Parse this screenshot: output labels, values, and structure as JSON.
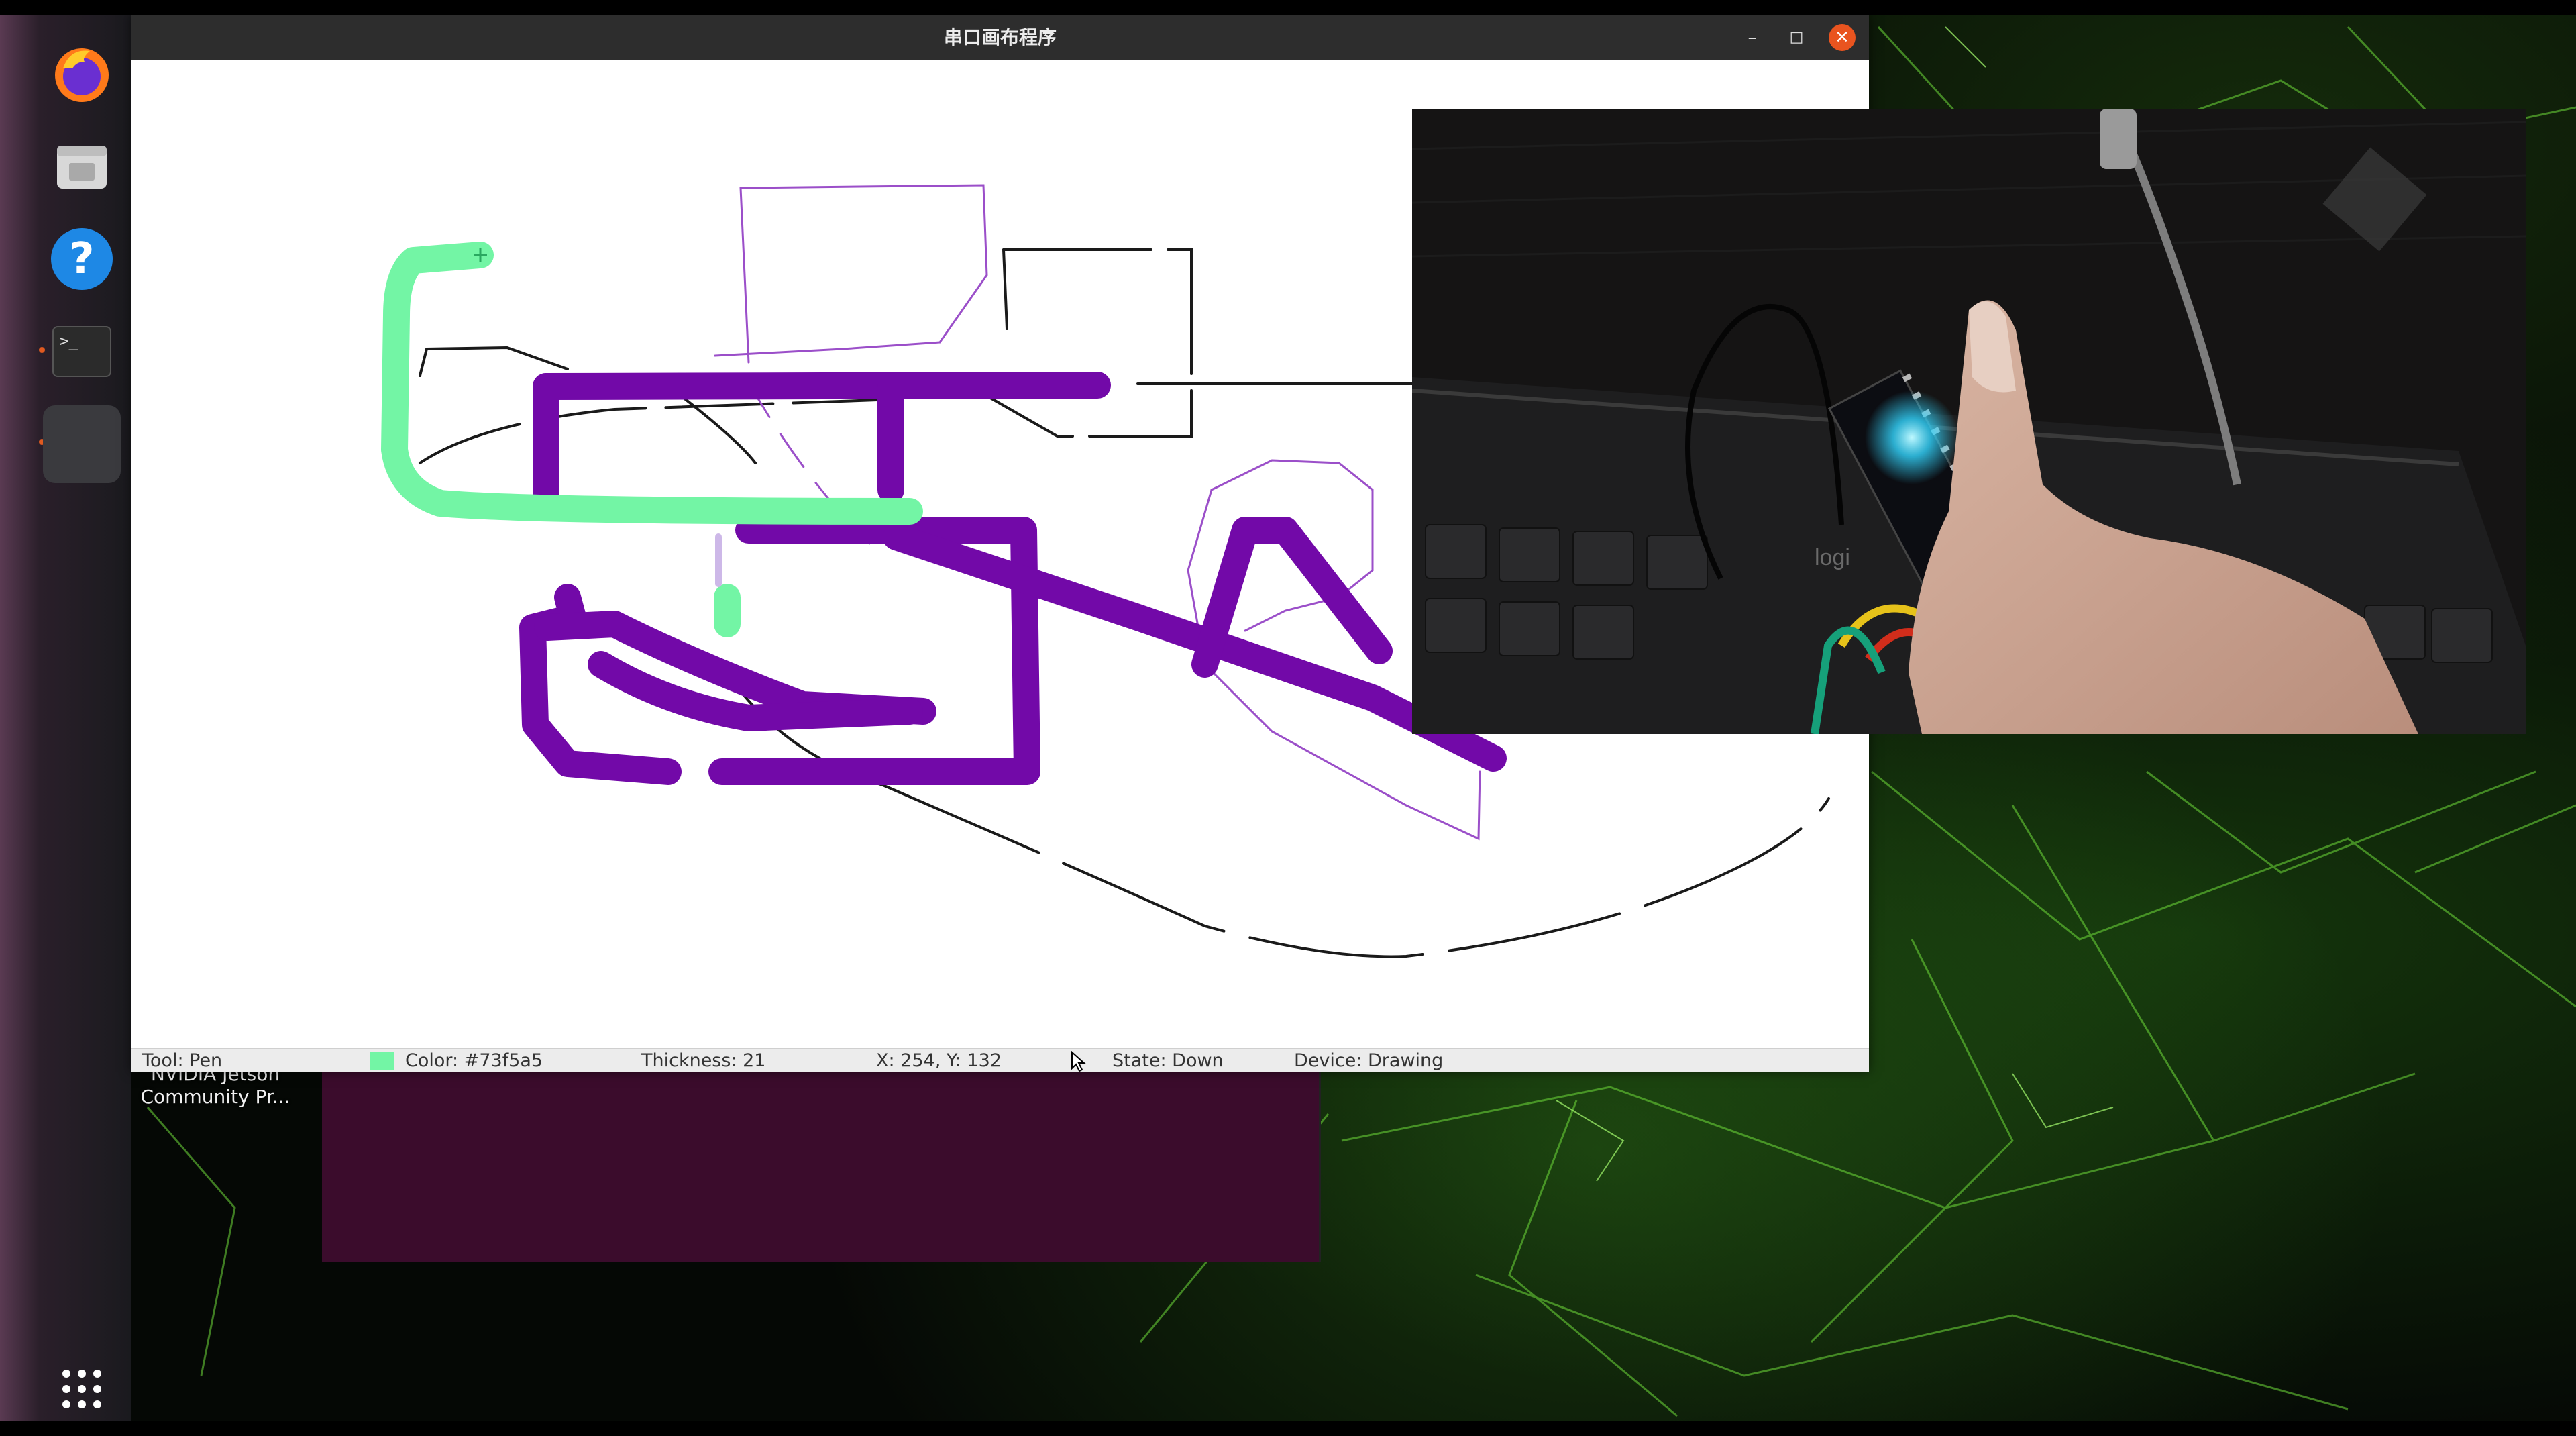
{
  "window": {
    "title": "串口画布程序",
    "minimize_glyph": "–",
    "maximize_glyph": "□",
    "close_glyph": "✕"
  },
  "dock": {
    "items": [
      {
        "name": "firefox-icon"
      },
      {
        "name": "files-icon"
      },
      {
        "name": "help-icon",
        "glyph": "?"
      },
      {
        "name": "terminal-icon",
        "glyph": ">_"
      },
      {
        "name": "active-app-icon"
      }
    ],
    "apps_grid_icon": "apps-grid-icon"
  },
  "desktop": {
    "icon_label_line1": "NVIDIA Jetson",
    "icon_label_line2": "Community Pr..."
  },
  "statusbar": {
    "tool": "Tool: Pen",
    "color": "Color: #73f5a5",
    "color_hex": "#73f5a5",
    "thickness": "Thickness: 21",
    "coords": "X: 254, Y: 132",
    "state": "State: Down",
    "device": "Device: Drawing"
  },
  "canvas": {
    "stroke_colors": {
      "purple": "#7209a8",
      "green": "#73f5a5",
      "thin_purple": "#9b4fc9",
      "black": "#1a1a1a"
    }
  },
  "camera": {
    "keyboard_brand": "logi"
  }
}
